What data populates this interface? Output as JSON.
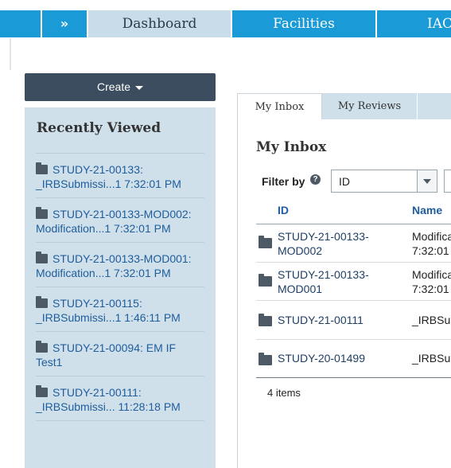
{
  "nav": {
    "tabs": [
      {
        "label": "Dashboard"
      },
      {
        "label": "Facilities"
      },
      {
        "label": "IAC"
      }
    ],
    "expand_icon": "double-chevron-right"
  },
  "create_button": {
    "label": "Create"
  },
  "recently_viewed": {
    "title": "Recently Viewed",
    "items": [
      {
        "line1": "STUDY-21-00133:",
        "line2": "_IRBSubmissi...1 7:32:01 PM"
      },
      {
        "line1": "STUDY-21-00133-MOD002:",
        "line2": "Modification...1 7:32:01 PM"
      },
      {
        "line1": "STUDY-21-00133-MOD001:",
        "line2": "Modification...1 7:32:01 PM"
      },
      {
        "line1": "STUDY-21-00115:",
        "line2": "_IRBSubmissi...1 1:46:11 PM"
      },
      {
        "line1": "STUDY-21-00094: EM IF",
        "line2": "Test1"
      },
      {
        "line1": "STUDY-21-00111:",
        "line2": "_IRBSubmissi... 11:28:18 PM"
      }
    ]
  },
  "tabs": [
    {
      "label": "My Inbox"
    },
    {
      "label": "My Reviews"
    }
  ],
  "inbox": {
    "title": "My Inbox",
    "filter_label": "Filter by",
    "filter_value": "ID",
    "columns": [
      "ID",
      "Name"
    ],
    "rows": [
      {
        "id_line1": "STUDY-21-00133-",
        "id_line2": "MOD002",
        "name_line1": "Modifica",
        "name_line2": "7:32:01"
      },
      {
        "id_line1": "STUDY-21-00133-",
        "id_line2": "MOD001",
        "name_line1": "Modifica",
        "name_line2": "7:32:01"
      },
      {
        "id_line1": "STUDY-21-00111",
        "id_line2": "",
        "name_line1": "_IRBSu",
        "name_line2": ""
      },
      {
        "id_line1": "STUDY-20-01499",
        "id_line2": "",
        "name_line1": "_IRBSu",
        "name_line2": ""
      }
    ],
    "items_count": "4 items"
  }
}
